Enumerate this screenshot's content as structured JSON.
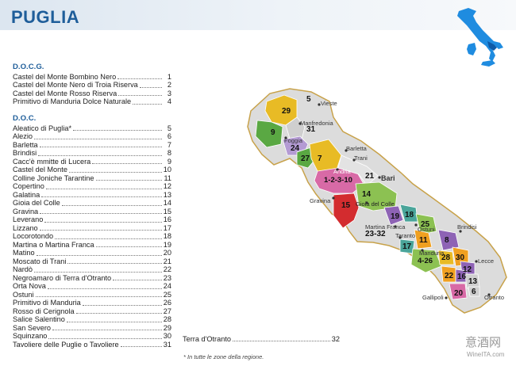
{
  "title": "PUGLIA",
  "docg": {
    "heading": "D.O.C.G.",
    "items": [
      {
        "name": "Castel del Monte Bombino Nero",
        "num": "1"
      },
      {
        "name": "Castel del Monte Nero di Troia Riserva",
        "num": "2"
      },
      {
        "name": "Castel del Monte Rosso Riserva",
        "num": "3"
      },
      {
        "name": "Primitivo di Manduria Dolce Naturale",
        "num": "4"
      }
    ]
  },
  "doc": {
    "heading": "D.O.C.",
    "items": [
      {
        "name": "Aleatico di Puglia*",
        "num": "5"
      },
      {
        "name": "Alezio",
        "num": "6"
      },
      {
        "name": "Barletta",
        "num": "7"
      },
      {
        "name": "Brindisi",
        "num": "8"
      },
      {
        "name": "Cacc'è mmitte di Lucera",
        "num": "9"
      },
      {
        "name": "Castel del Monte",
        "num": "10"
      },
      {
        "name": "Colline Joniche Tarantine",
        "num": "11"
      },
      {
        "name": "Copertino",
        "num": "12"
      },
      {
        "name": "Galatina",
        "num": "13"
      },
      {
        "name": "Gioia del Colle",
        "num": "14"
      },
      {
        "name": "Gravina",
        "num": "15"
      },
      {
        "name": "Leverano",
        "num": "16"
      },
      {
        "name": "Lizzano",
        "num": "17"
      },
      {
        "name": "Locorotondo",
        "num": "18"
      },
      {
        "name": "Martina o Martina Franca",
        "num": "19"
      },
      {
        "name": "Matino",
        "num": "20"
      },
      {
        "name": "Moscato di Trani",
        "num": "21"
      },
      {
        "name": "Nardò",
        "num": "22"
      },
      {
        "name": "Negroamaro di Terra d'Otranto",
        "num": "23"
      },
      {
        "name": "Orta Nova",
        "num": "24"
      },
      {
        "name": "Ostuni",
        "num": "25"
      },
      {
        "name": "Primitivo di Manduria",
        "num": "26"
      },
      {
        "name": "Rosso di Cerignola",
        "num": "27"
      },
      {
        "name": "Salice Salentino",
        "num": "28"
      },
      {
        "name": "San Severo",
        "num": "29"
      },
      {
        "name": "Squinzano",
        "num": "30"
      },
      {
        "name": "Tavoliere delle Puglie o Tavoliere",
        "num": "31"
      }
    ]
  },
  "terra": {
    "name": "Terra d'Otranto",
    "num": "32"
  },
  "footnote": "* In tutte le zone della regione.",
  "cities": {
    "vieste": "Vieste",
    "manfredonia": "Manfredonia",
    "foggia": "Foggia",
    "barletta": "Barletta",
    "trani": "Trani",
    "andria": "Andria",
    "bari": "Bari",
    "gravina": "Gravina",
    "gioia": "Gioia del Colle",
    "martina": "Martina Franca",
    "ostuni": "Ostuni",
    "brindisi": "Brindisi",
    "taranto": "Taranto",
    "manduria": "Manduria",
    "lecce": "Lecce",
    "gallipoli": "Gallipoli",
    "otranto": "Otranto"
  },
  "zones": {
    "z5": "5",
    "z29": "29",
    "z9": "9",
    "z31": "31",
    "z24": "24",
    "z27": "27",
    "z7": "7",
    "z1": "1-2-3-10",
    "z21": "21",
    "z15": "15",
    "z14": "14",
    "z19": "19",
    "z18": "18",
    "z25": "25",
    "z23": "23-32",
    "z11": "11",
    "z17": "17",
    "z8": "8",
    "z4": "4-26",
    "z28": "28",
    "z30": "30",
    "z12": "12",
    "z22": "22",
    "z16": "16",
    "z13": "13",
    "z20": "20",
    "z6": "6"
  },
  "watermark": {
    "cn": "意酒网",
    "url": "WineITA.com"
  },
  "colors": {
    "title": "#1f5e9a",
    "region": "#dcdcdc",
    "border": "#c8a24a",
    "green": "#5aa843",
    "light_green": "#8cc152",
    "yellow": "#e8bb25",
    "orange": "#f0a020",
    "purple": "#8e63b5",
    "pink": "#d86aa6",
    "red": "#d32c2f",
    "teal": "#4aa59a",
    "italy": "#1f8ce0"
  }
}
